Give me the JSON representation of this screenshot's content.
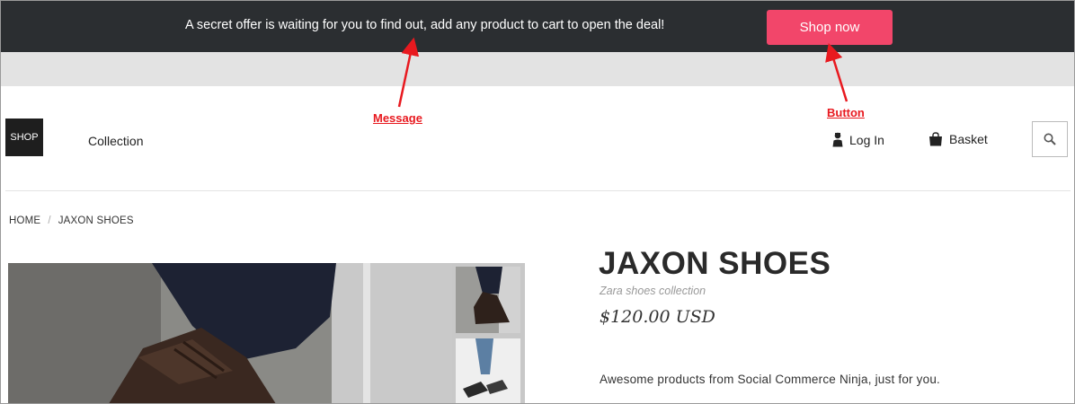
{
  "promo": {
    "message": "A secret offer is waiting for you to find out, add any product to cart to open the deal!",
    "button_label": "Shop now",
    "button_color": "#f2466a",
    "bar_color": "#2b2e31"
  },
  "annotations": {
    "message_label": "Message",
    "button_label": "Button",
    "color": "#e8191f"
  },
  "header": {
    "logo_text": "SHOP",
    "nav_collection": "Collection",
    "login_label": "Log In",
    "basket_label": "Basket",
    "icons": [
      "user-icon",
      "bag-icon",
      "search-icon"
    ]
  },
  "breadcrumb": {
    "home": "HOME",
    "separator": "/",
    "current": "JAXON SHOES"
  },
  "product": {
    "title": "JAXON SHOES",
    "subtitle": "Zara shoes collection",
    "price": "$120.00 USD",
    "description": "Awesome products from Social Commerce Ninja, just for you."
  }
}
